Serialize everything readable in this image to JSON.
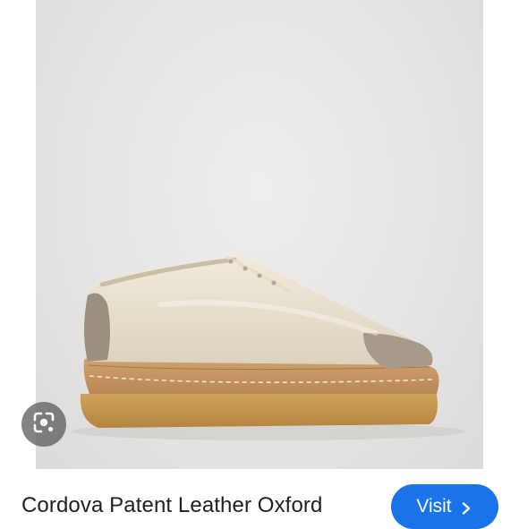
{
  "product": {
    "title": "Cordova Patent Leather Oxford",
    "image_alt": "Cream patent leather oxford shoe with taupe cap toe and crepe sole"
  },
  "actions": {
    "visit_label": "Visit",
    "visit_icon": "chevron-right-icon",
    "lens_icon": "lens-search-icon"
  },
  "colors": {
    "accent": "#1a73e8",
    "title_text": "#1f1f1f",
    "photo_background": "#e6e5e3"
  }
}
